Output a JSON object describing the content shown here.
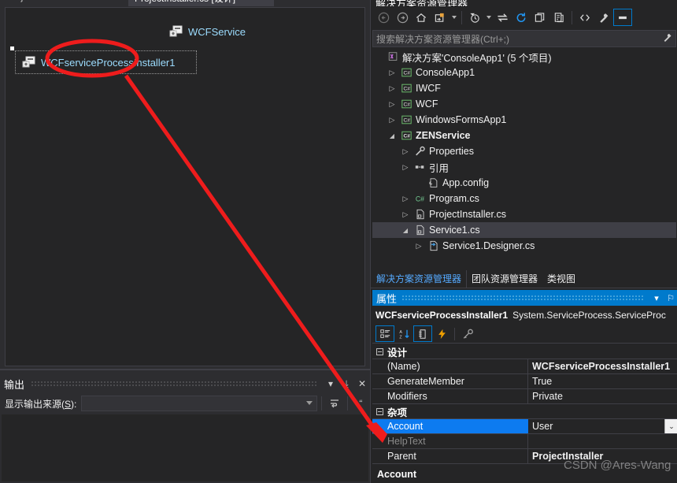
{
  "designer": {
    "tabs": [
      {
        "label": "ProjectInstaller.cs",
        "active": false
      },
      {
        "label": "ProjectInstaller.cs [设计]",
        "active": true
      }
    ],
    "overflow_glyph": "▾",
    "components": [
      {
        "name": "WCFService",
        "icon": "component-icon",
        "selected": false
      },
      {
        "name": "WCFserviceProcessInstaller1",
        "icon": "component-icon",
        "selected": true
      }
    ]
  },
  "output": {
    "title": "输出",
    "source_label_pre": "显示输出来源(",
    "source_label_key": "S",
    "source_label_post": "):",
    "combo_value": "",
    "dropdown_glyph": "▾",
    "pin_glyph": "⤓",
    "close_glyph": "✕",
    "toolbar_icons": [
      "wrap-text-icon",
      "quote-icon"
    ]
  },
  "solution_explorer": {
    "caption": "解决方案资源管理器",
    "toolbar": [
      {
        "name": "back-icon",
        "glyph": "←",
        "dim": true
      },
      {
        "name": "forward-icon",
        "glyph": "→",
        "dim": true
      },
      {
        "name": "home-icon",
        "glyph": "⌂",
        "dim": false
      },
      {
        "name": "new-folder-icon",
        "glyph": "▢",
        "dim": false
      },
      {
        "name": "pending-changes-icon",
        "glyph": "◴",
        "dim": false
      },
      {
        "name": "sync-icon",
        "glyph": "⇄",
        "dim": false
      },
      {
        "name": "refresh-icon",
        "glyph": "↻",
        "dim": false
      },
      {
        "name": "collapse-all-icon",
        "glyph": "⧉",
        "dim": false
      },
      {
        "name": "properties-window-icon",
        "glyph": "❐",
        "dim": false
      },
      {
        "name": "show-all-files-icon",
        "glyph": "<>",
        "dim": false
      },
      {
        "name": "view-code-icon",
        "glyph": "⚒",
        "dim": false
      },
      {
        "name": "view-designer-icon",
        "glyph": "▬",
        "dim": false,
        "boxed": true
      }
    ],
    "search_placeholder": "搜索解决方案资源管理器(Ctrl+;)",
    "search_icon": "search-wrench-icon",
    "tree": [
      {
        "label": "解决方案'ConsoleApp1' (5 个项目)",
        "indent": 0,
        "twisty": "",
        "icon": "solution-icon",
        "bold": false,
        "selected": false
      },
      {
        "label": "ConsoleApp1",
        "indent": 1,
        "twisty": "▹",
        "icon": "csharp-project-icon",
        "bold": false,
        "selected": false
      },
      {
        "label": "IWCF",
        "indent": 1,
        "twisty": "▹",
        "icon": "csharp-project-icon",
        "bold": false,
        "selected": false
      },
      {
        "label": "WCF",
        "indent": 1,
        "twisty": "▹",
        "icon": "csharp-project-icon",
        "bold": false,
        "selected": false
      },
      {
        "label": "WindowsFormsApp1",
        "indent": 1,
        "twisty": "▹",
        "icon": "csharp-project-icon",
        "bold": false,
        "selected": false
      },
      {
        "label": "ZENService",
        "indent": 1,
        "twisty": "▿",
        "icon": "csharp-project-icon",
        "bold": true,
        "selected": false
      },
      {
        "label": "Properties",
        "indent": 2,
        "twisty": "▹",
        "icon": "wrench-icon",
        "bold": false,
        "selected": false
      },
      {
        "label": "引用",
        "indent": 2,
        "twisty": "▹",
        "icon": "references-icon",
        "bold": false,
        "selected": false
      },
      {
        "label": "App.config",
        "indent": 3,
        "twisty": "",
        "icon": "config-file-icon",
        "bold": false,
        "selected": false
      },
      {
        "label": "Program.cs",
        "indent": 2,
        "twisty": "▹",
        "icon": "csharp-file-icon",
        "bold": false,
        "selected": false
      },
      {
        "label": "ProjectInstaller.cs",
        "indent": 2,
        "twisty": "▹",
        "icon": "form-file-icon",
        "bold": false,
        "selected": false
      },
      {
        "label": "Service1.cs",
        "indent": 2,
        "twisty": "▿",
        "icon": "form-file-icon",
        "bold": false,
        "selected": true
      },
      {
        "label": "Service1.Designer.cs",
        "indent": 3,
        "twisty": "▹",
        "icon": "designer-file-icon",
        "bold": false,
        "selected": false
      }
    ],
    "tabs": [
      {
        "label": "解决方案资源管理器",
        "active": true
      },
      {
        "label": "团队资源管理器",
        "active": false
      },
      {
        "label": "类视图",
        "active": false
      }
    ]
  },
  "properties": {
    "title": "属性",
    "dropdown_glyph": "▾",
    "pin_glyph": "⚐",
    "object_name": "WCFserviceProcessInstaller1",
    "object_type": "System.ServiceProcess.ServiceProc",
    "toolbar": [
      {
        "name": "categorized-view-icon",
        "glyph": "☷",
        "boxed": true
      },
      {
        "name": "alphabetical-sort-icon",
        "glyph": "↓",
        "boxed": false
      },
      {
        "name": "properties-page-icon",
        "glyph": "◰",
        "boxed": true
      },
      {
        "name": "events-icon",
        "glyph": "⚡",
        "boxed": false
      },
      {
        "name": "property-pages-key-icon",
        "glyph": "⚷",
        "boxed": false
      }
    ],
    "groups": [
      {
        "name": "设计",
        "rows": [
          {
            "name": "(Name)",
            "value": "WCFserviceProcessInstaller1",
            "bold": true,
            "selected": false,
            "dim": false,
            "dropdown": false
          },
          {
            "name": "GenerateMember",
            "value": "True",
            "bold": false,
            "selected": false,
            "dim": false,
            "dropdown": false
          },
          {
            "name": "Modifiers",
            "value": "Private",
            "bold": false,
            "selected": false,
            "dim": false,
            "dropdown": false
          }
        ]
      },
      {
        "name": "杂项",
        "rows": [
          {
            "name": "Account",
            "value": "User",
            "bold": false,
            "selected": true,
            "dim": false,
            "dropdown": true,
            "dropdown_glyph": "⌄"
          },
          {
            "name": "HelpText",
            "value": "",
            "bold": false,
            "selected": false,
            "dim": true,
            "dropdown": false
          },
          {
            "name": "Parent",
            "value": "ProjectInstaller",
            "bold": true,
            "selected": false,
            "dim": false,
            "dropdown": false
          }
        ]
      }
    ],
    "description_title": "Account"
  },
  "annotations": {
    "ellipse_color": "#ee1c1c",
    "arrow_color": "#ee1c1c",
    "watermark": "CSDN @Ares-Wang"
  }
}
